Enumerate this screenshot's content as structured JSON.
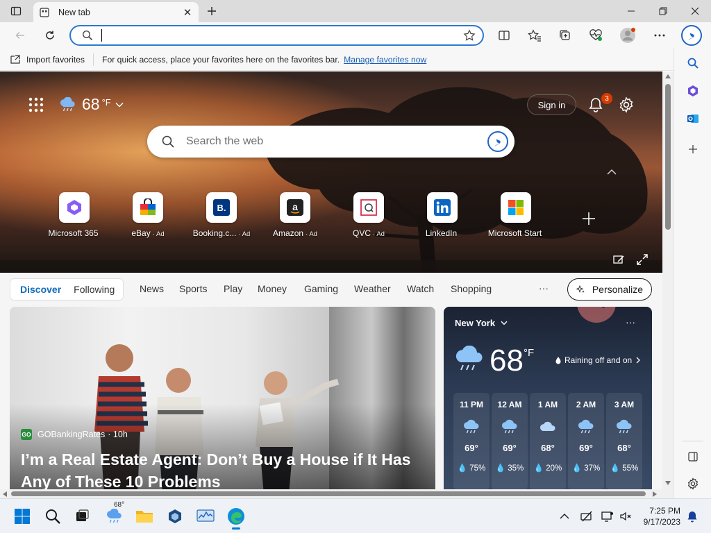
{
  "browser": {
    "tab_title": "New tab",
    "address_value": "",
    "favbar": {
      "import_label": "Import favorites",
      "message": "For quick access, place your favorites here on the favorites bar.",
      "link": "Manage favorites now"
    }
  },
  "ntp": {
    "weather": {
      "temp": "68",
      "unit": "°F"
    },
    "sign_in": "Sign in",
    "notification_count": "3",
    "search_placeholder": "Search the web",
    "tiles": [
      {
        "name": "Microsoft 365",
        "ad": ""
      },
      {
        "name": "eBay",
        "ad": "· Ad"
      },
      {
        "name": "Booking.c...",
        "ad": "· Ad"
      },
      {
        "name": "Amazon",
        "ad": "· Ad"
      },
      {
        "name": "QVC",
        "ad": "· Ad"
      },
      {
        "name": "LinkedIn",
        "ad": ""
      },
      {
        "name": "Microsoft Start",
        "ad": ""
      }
    ]
  },
  "feed": {
    "tabs": [
      "Discover",
      "Following"
    ],
    "nav": [
      "News",
      "Sports",
      "Play",
      "Money",
      "Gaming",
      "Weather",
      "Watch",
      "Shopping"
    ],
    "more": "···",
    "personalize": "Personalize",
    "article": {
      "source": "GOBankingRates",
      "source_logo": "GO",
      "age": "· 10h",
      "headline": "I’m a Real Estate Agent: Don’t Buy a House if It Has Any of These 10 Problems"
    },
    "weather_card": {
      "city": "New York",
      "temp": "68",
      "unit": "°F",
      "condition": "Raining off and on",
      "hourly": [
        {
          "time": "11 PM",
          "temp": "69°",
          "precip": "75%"
        },
        {
          "time": "12 AM",
          "temp": "69°",
          "precip": "35%"
        },
        {
          "time": "1 AM",
          "temp": "68°",
          "precip": "20%"
        },
        {
          "time": "2 AM",
          "temp": "69°",
          "precip": "37%"
        },
        {
          "time": "3 AM",
          "temp": "68°",
          "precip": "55%"
        }
      ]
    }
  },
  "taskbar": {
    "weather_badge": "68°",
    "time": "7:25 PM",
    "date": "9/17/2023"
  },
  "colors": {
    "accent": "#0f6cbd",
    "edge_blue": "#2b78d0",
    "badge": "#d83b01"
  }
}
